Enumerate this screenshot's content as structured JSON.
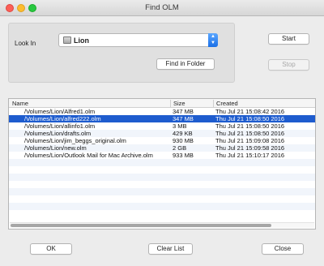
{
  "window": {
    "title": "Find OLM"
  },
  "search": {
    "look_in_label": "Look In",
    "look_in_value": "Lion",
    "find_in_folder_label": "Find in Folder"
  },
  "actions": {
    "start_label": "Start",
    "stop_label": "Stop",
    "ok_label": "OK",
    "clear_list_label": "Clear List",
    "close_label": "Close"
  },
  "table": {
    "columns": [
      "Name",
      "Size",
      "Created"
    ],
    "rows": [
      {
        "name": "/Volumes/Lion/Alfred1.olm",
        "size": "347 MB",
        "created": "Thu Jul 21 15:08:42 2016",
        "selected": false
      },
      {
        "name": "/Volumes/Lion/alfred222.olm",
        "size": "347 MB",
        "created": "Thu Jul 21 15:08:50 2016",
        "selected": true
      },
      {
        "name": "/Volumes/Lion/allinfo1.olm",
        "size": "3 MB",
        "created": "Thu Jul 21 15:08:50 2016",
        "selected": false
      },
      {
        "name": "/Volumes/Lion/drafts.olm",
        "size": "429 KB",
        "created": "Thu Jul 21 15:08:50 2016",
        "selected": false
      },
      {
        "name": "/Volumes/Lion/jim_beggs_original.olm",
        "size": "930 MB",
        "created": "Thu Jul 21 15:09:08 2016",
        "selected": false
      },
      {
        "name": "/Volumes/Lion/new.olm",
        "size": "2 GB",
        "created": "Thu Jul 21 15:09:58 2016",
        "selected": false
      },
      {
        "name": "/Volumes/Lion/Outlook Mail for Mac Archive.olm",
        "size": "933 MB",
        "created": "Thu Jul 21 15:10:17 2016",
        "selected": false
      }
    ]
  }
}
